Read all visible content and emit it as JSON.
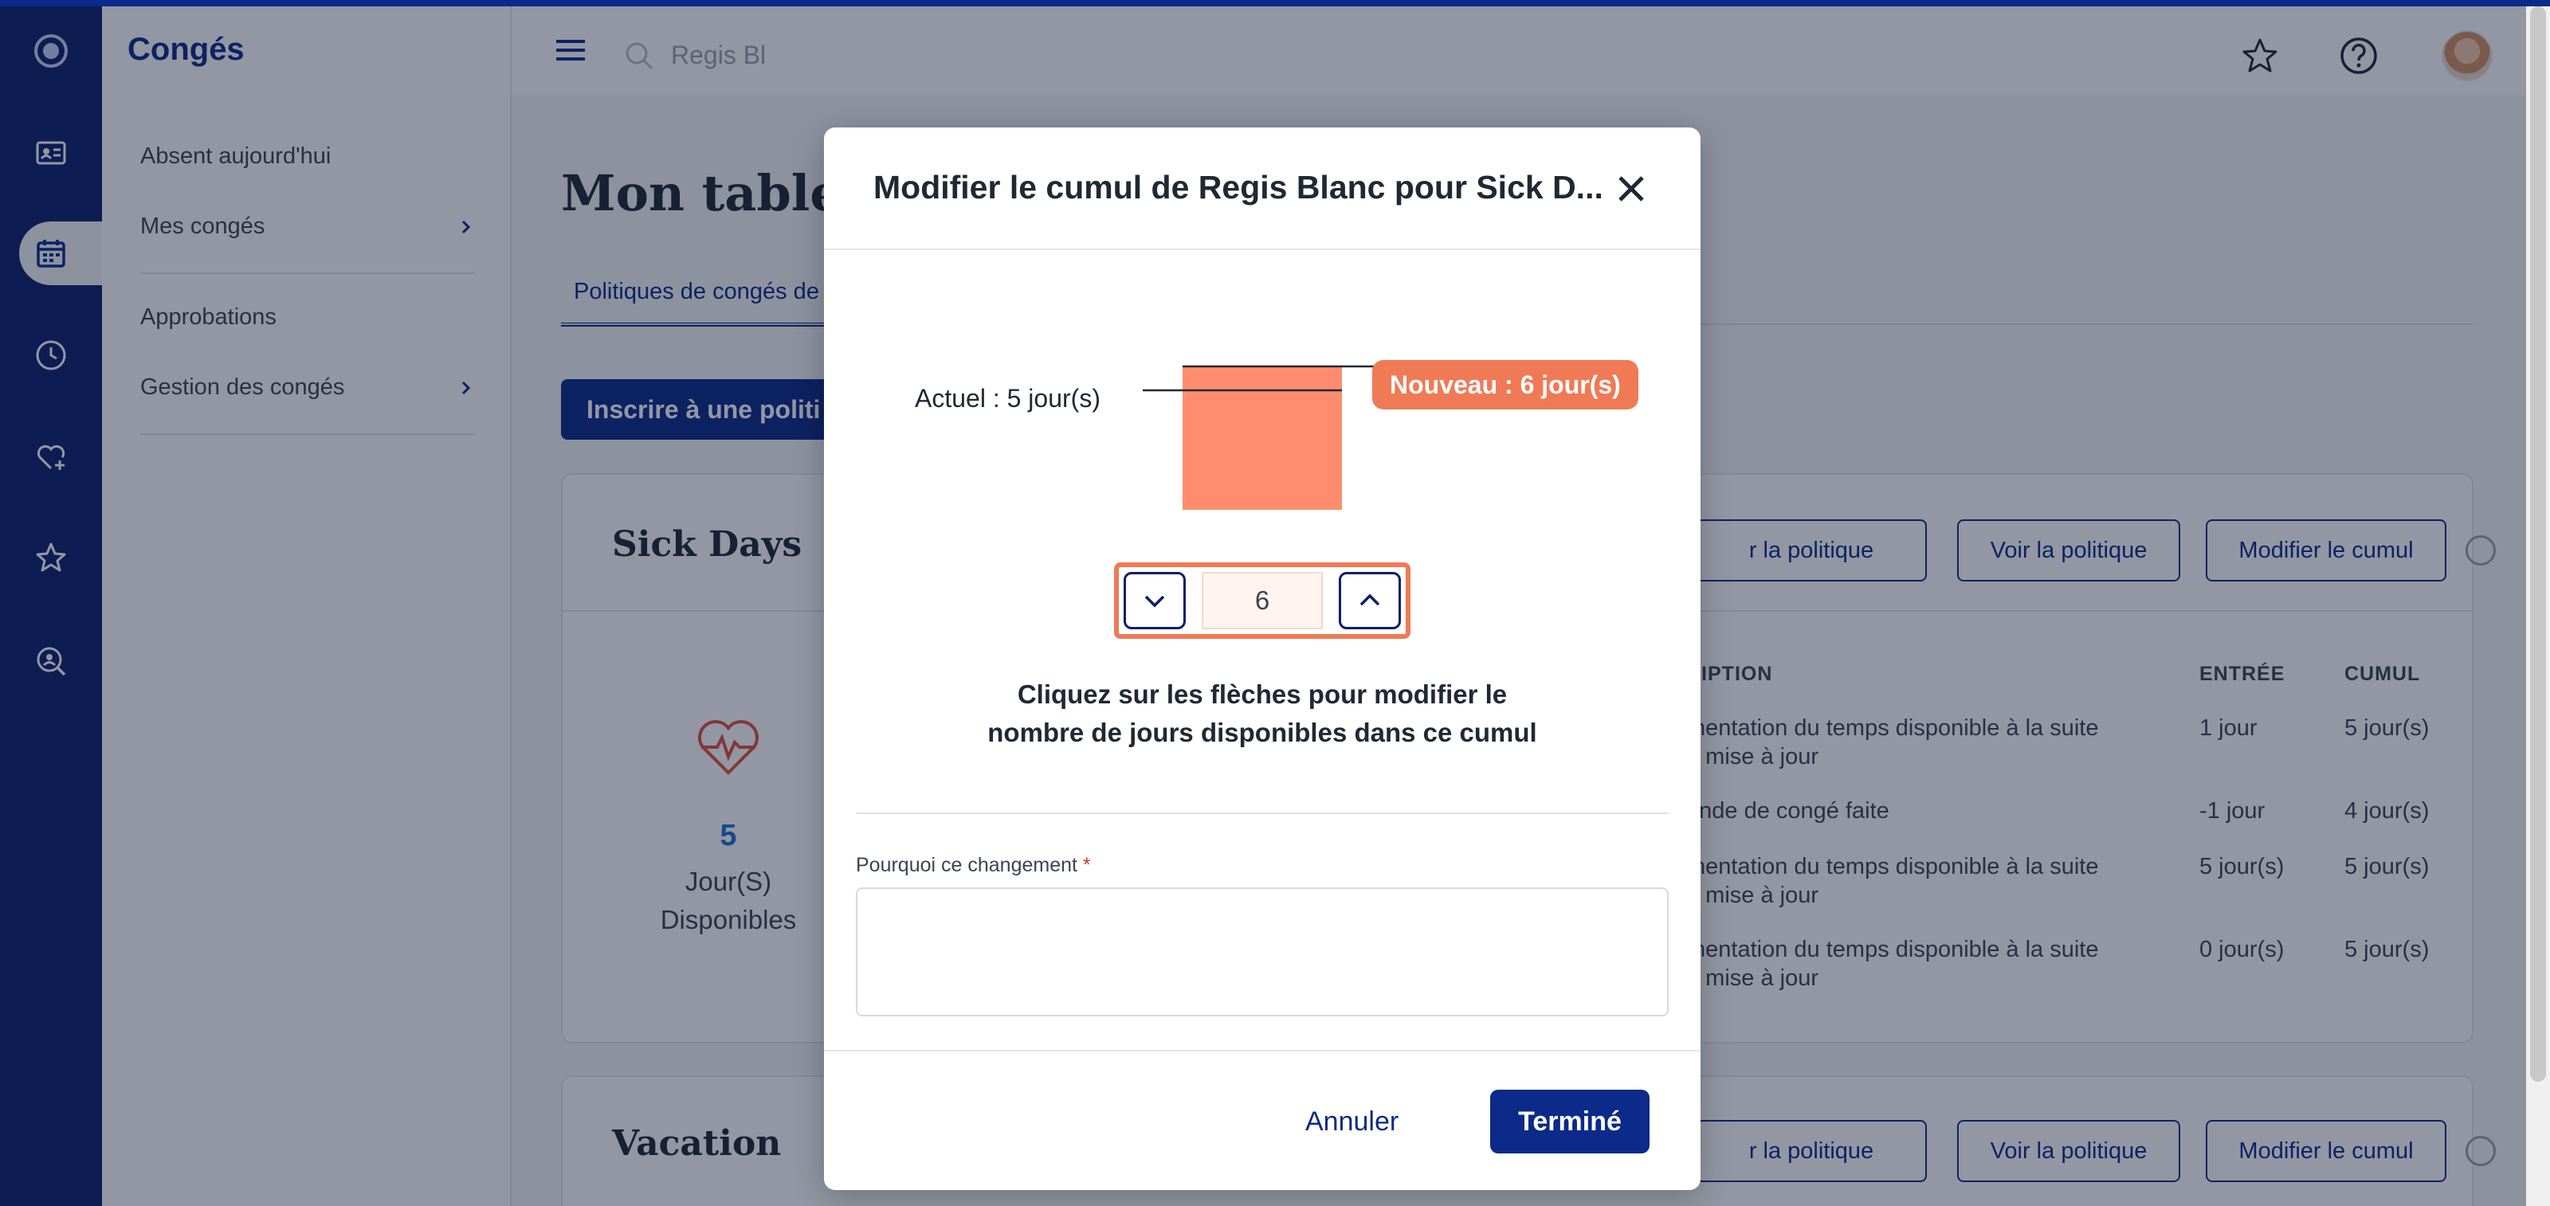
{
  "app": {
    "title": "Congés"
  },
  "sidebar": {
    "items": [
      {
        "label": "Absent aujourd'hui"
      },
      {
        "label": "Mes congés"
      },
      {
        "label": "Approbations"
      },
      {
        "label": "Gestion des congés"
      }
    ]
  },
  "search": {
    "value": "Regis Bl"
  },
  "page": {
    "title": "Mon tableau",
    "tab": "Politiques de congés de",
    "enroll_button": "Inscrire à une politi"
  },
  "cards": [
    {
      "title": "Sick Days",
      "buttons": [
        "r la politique",
        "Voir la politique",
        "Modifier le cumul"
      ],
      "available": {
        "number": "5",
        "unit": "Jour(S)",
        "label": "Disponibles"
      },
      "table": {
        "headers": [
          "RIPTION",
          "ENTRÉE",
          "CUMUL"
        ],
        "rows": [
          {
            "desc1": "mentation du temps disponible à la suite",
            "desc2": "e mise à jour",
            "entry": "1 jour",
            "cumul": "5 jour(s)"
          },
          {
            "desc1": "ande de congé faite",
            "desc2": "",
            "entry": "-1 jour",
            "cumul": "4 jour(s)"
          },
          {
            "desc1": "mentation du temps disponible à la suite",
            "desc2": "e mise à jour",
            "entry": "5 jour(s)",
            "cumul": "5 jour(s)"
          },
          {
            "desc1": "mentation du temps disponible à la suite",
            "desc2": "e mise à jour",
            "entry": "0 jour(s)",
            "cumul": "5 jour(s)"
          }
        ]
      }
    },
    {
      "title": "Vacation",
      "buttons": [
        "r la politique",
        "Voir la politique",
        "Modifier le cumul"
      ]
    }
  ],
  "modal": {
    "title": "Modifier le cumul de Regis Blanc pour Sick D...",
    "actual_label": "Actuel : 5 jour(s)",
    "new_label": "Nouveau : 6 jour(s)",
    "actual_days": 5,
    "new_days": 6,
    "stepper_value": "6",
    "help_line1": "Cliquez sur les flèches pour modifier le",
    "help_line2": "nombre de jours disponibles dans ce cumul",
    "reason_label": "Pourquoi ce changement",
    "required_mark": "*",
    "reason_value": "",
    "cancel": "Annuler",
    "done": "Terminé"
  },
  "colors": {
    "brand": "#0b2a8a",
    "rail": "#0b1f6e",
    "accent_orange": "#f07a55",
    "bar_fill": "#ff8c6e"
  },
  "icons": [
    "logo-icon",
    "contact-card-icon",
    "calendar-icon",
    "clock-icon",
    "heart-plus-icon",
    "star-icon",
    "search-person-icon",
    "menu-icon",
    "search-icon",
    "favorite-star-icon",
    "help-icon",
    "close-icon",
    "chevron-down-icon",
    "chevron-up-icon",
    "heart-pulse-icon"
  ]
}
